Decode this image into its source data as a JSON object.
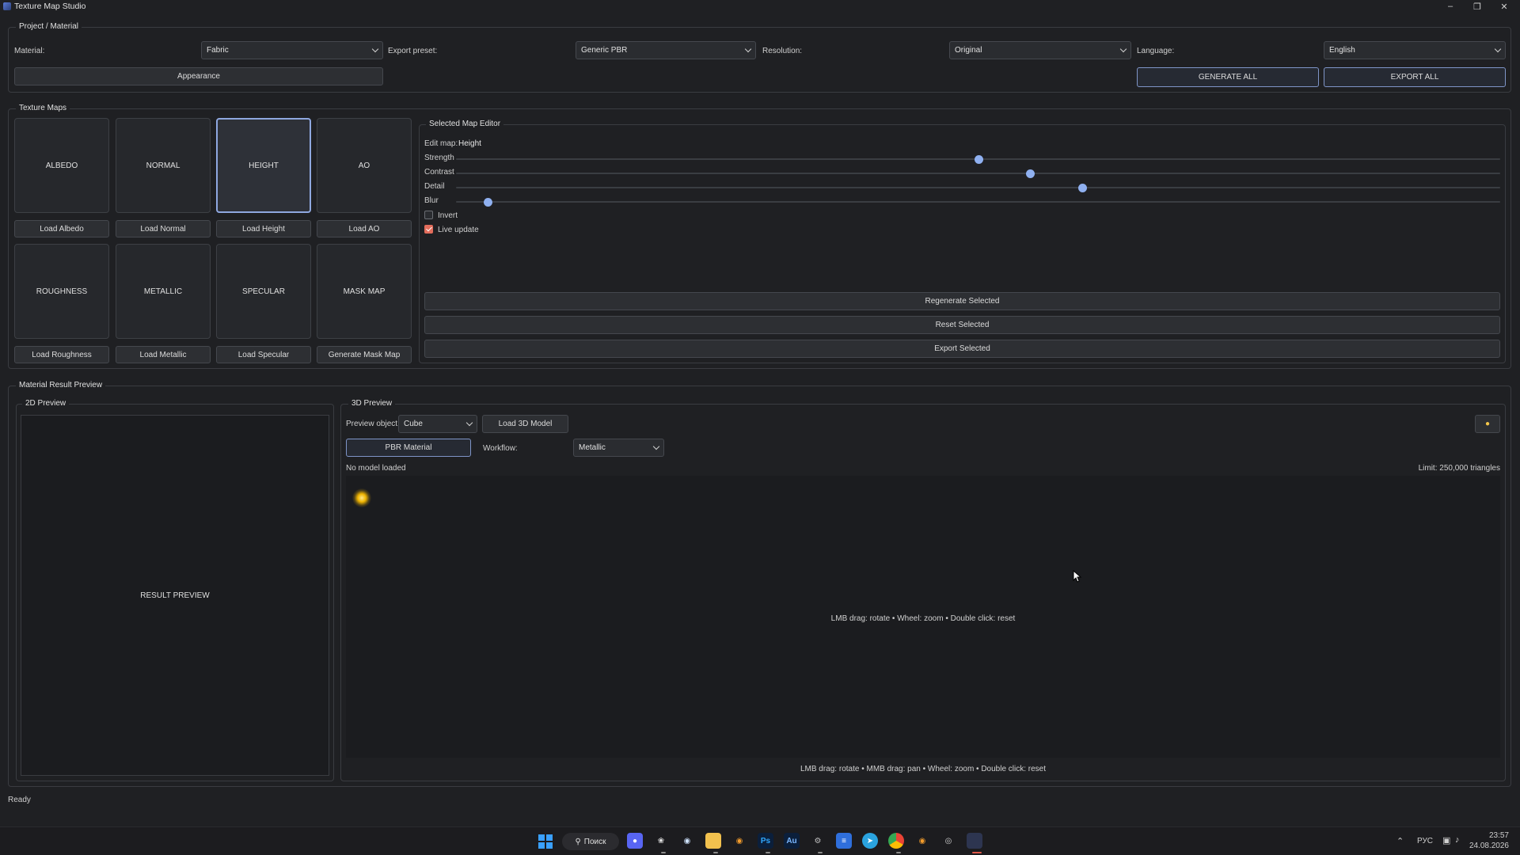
{
  "window": {
    "title": "Texture Map Studio"
  },
  "project": {
    "group_title": "Project / Material",
    "material_label": "Material:",
    "material_value": "Fabric",
    "export_preset_label": "Export preset:",
    "export_preset_value": "Generic PBR",
    "resolution_label": "Resolution:",
    "resolution_value": "Original",
    "language_label": "Language:",
    "language_value": "English",
    "appearance_button": "Appearance",
    "generate_all_button": "GENERATE ALL",
    "export_all_button": "EXPORT ALL"
  },
  "texture_maps": {
    "group_title": "Texture Maps",
    "tiles": [
      "ALBEDO",
      "NORMAL",
      "HEIGHT",
      "AO",
      "ROUGHNESS",
      "METALLIC",
      "SPECULAR",
      "MASK MAP"
    ],
    "buttons": [
      "Load Albedo",
      "Load Normal",
      "Load Height",
      "Load AO",
      "Load Roughness",
      "Load Metallic",
      "Load Specular",
      "Generate Mask Map"
    ],
    "selected": "HEIGHT"
  },
  "editor": {
    "group_title": "Selected Map Editor",
    "edit_map_label": "Edit map:",
    "edit_map_value": "Height",
    "sliders": [
      {
        "label": "Strength",
        "value": 0.5
      },
      {
        "label": "Contrast",
        "value": 0.55
      },
      {
        "label": "Detail",
        "value": 0.6
      },
      {
        "label": "Blur",
        "value": 0.03
      }
    ],
    "invert_label": "Invert",
    "invert_checked": false,
    "live_update_label": "Live update",
    "live_update_checked": true,
    "regenerate_button": "Regenerate Selected",
    "reset_button": "Reset Selected",
    "export_button": "Export Selected"
  },
  "result": {
    "group_title": "Material Result Preview",
    "preview2d_title": "2D Preview",
    "preview2d_text": "RESULT PREVIEW",
    "preview3d_title": "3D Preview",
    "preview_object_label": "Preview object:",
    "preview_object_value": "Cube",
    "load_model_button": "Load 3D Model",
    "pbr_material_button": "PBR Material",
    "workflow_label": "Workflow:",
    "workflow_value": "Metallic",
    "no_model_text": "No model loaded",
    "limit_text": "Limit: 250,000 triangles",
    "viewport_hint": "LMB drag: rotate  •  Wheel: zoom  •  Double click: reset",
    "footer_hint": "LMB drag: rotate  •  MMB drag: pan  •  Wheel: zoom  •  Double click: reset"
  },
  "status": {
    "text": "Ready"
  },
  "taskbar": {
    "search_label": "Поиск",
    "lang": "РУС",
    "time": "23:57",
    "date": "24.08.2026"
  },
  "colors": {
    "accent": "#8fb0f0",
    "checkbox_on": "#e26d5c",
    "background": "#1f2023"
  }
}
